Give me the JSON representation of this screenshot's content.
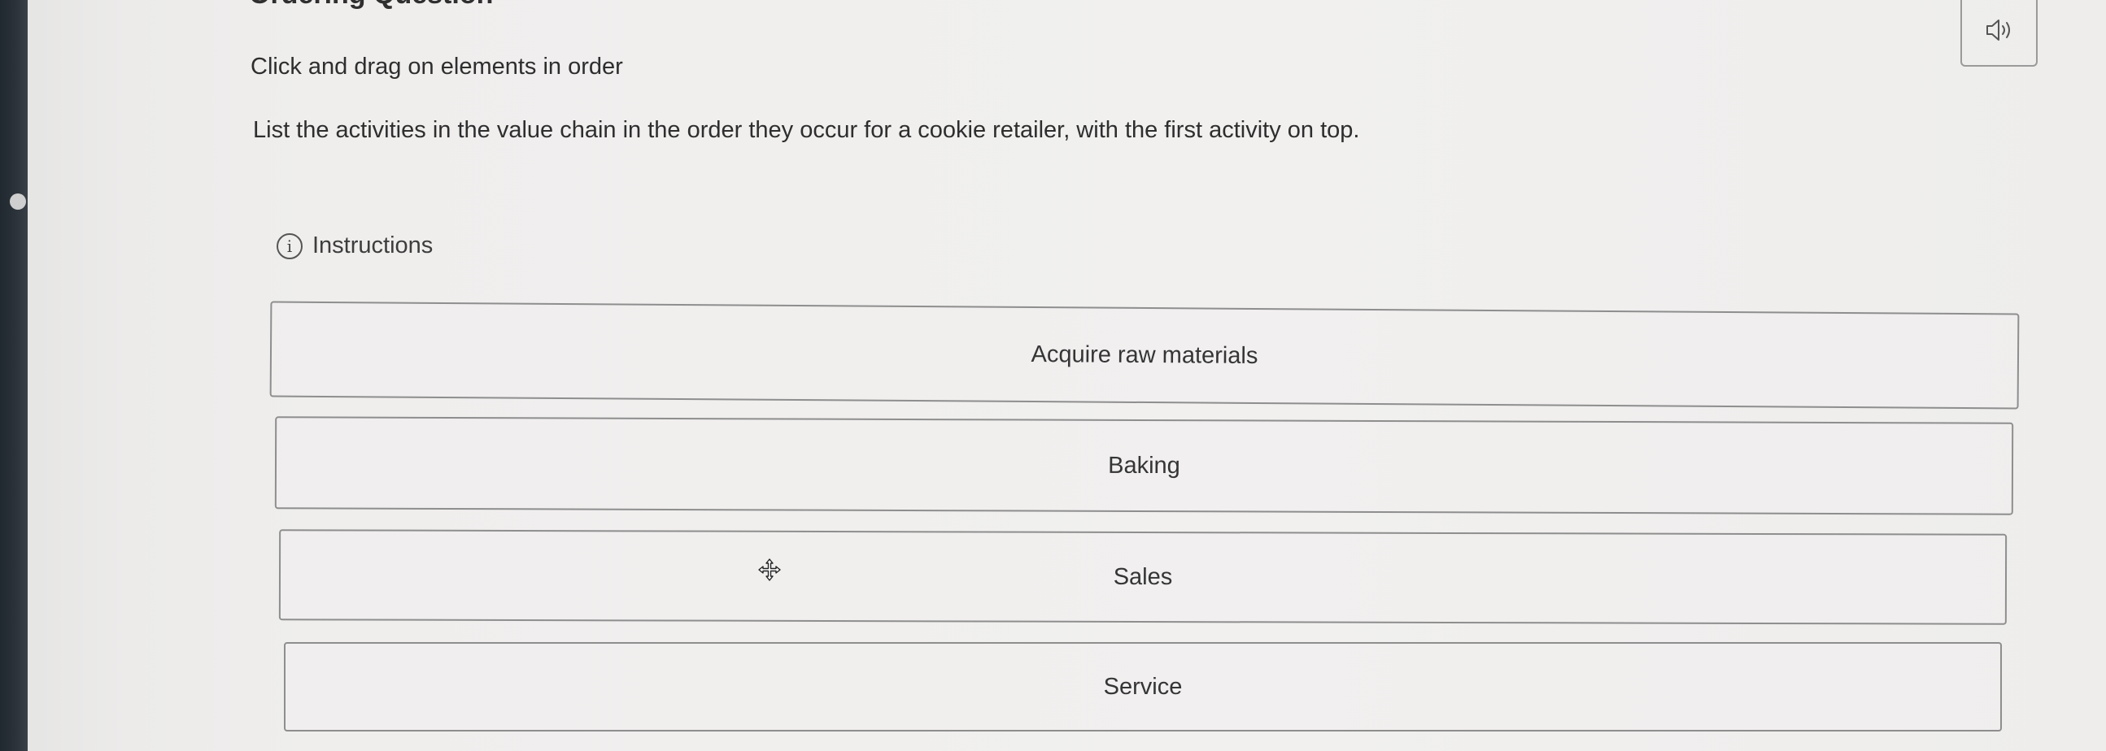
{
  "header": {
    "title": "Ordering Question",
    "prompt_label": "Click and drag on elements in order",
    "question": "List the activities in the value chain in the order they occur for a cookie retailer, with the first activity on top."
  },
  "instructions": {
    "icon": "info-icon",
    "label": "Instructions"
  },
  "audio_button": {
    "icon": "speaker-icon"
  },
  "items": [
    {
      "label": "Acquire raw materials"
    },
    {
      "label": "Baking"
    },
    {
      "label": "Sales"
    },
    {
      "label": "Service"
    }
  ],
  "cursor": {
    "icon": "move-cursor-icon"
  }
}
